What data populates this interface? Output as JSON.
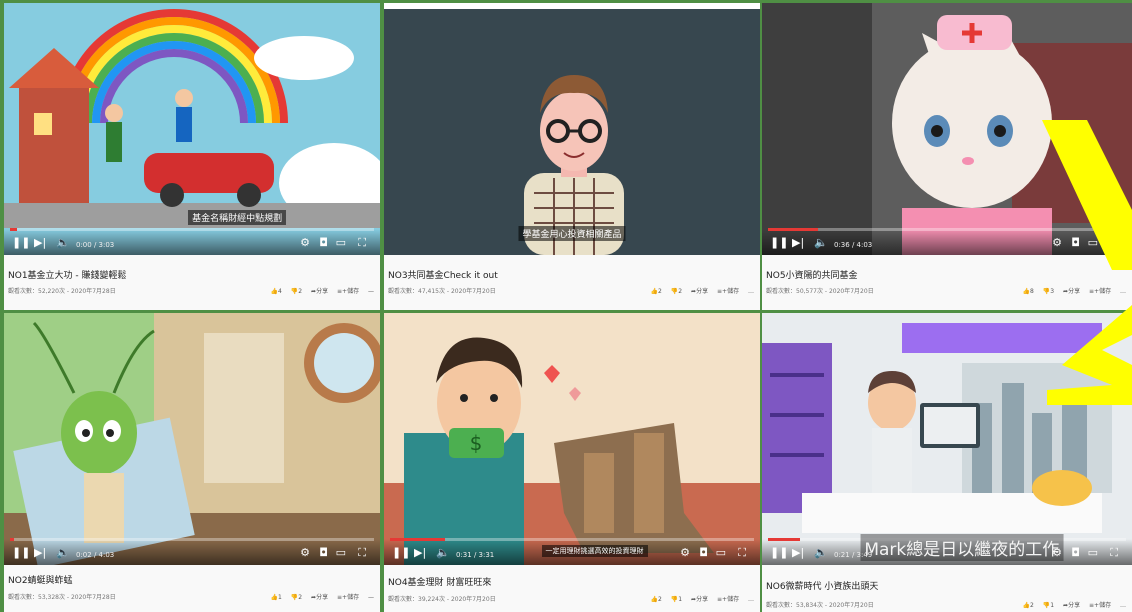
{
  "videos": [
    {
      "title": "NO1基金立大功 - 賺錢變輕鬆",
      "meta": "觀看次數：52,220次 - 2020年7月28日",
      "likes": "4",
      "dislikes": "2",
      "share": "分享",
      "save": "儲存",
      "time": "0:00 / 3:03",
      "subtitle": "基金名稱財經中點規劃"
    },
    {
      "title": "NO3共同基金Check it out",
      "meta": "觀看次數：47,415次 - 2020年7月20日",
      "likes": "2",
      "dislikes": "2",
      "share": "分享",
      "save": "儲存",
      "time": "",
      "subtitle": "學基金用心投資相關產品"
    },
    {
      "title": "NO5小資陽的共同基金",
      "meta": "觀看次數：50,577次 - 2020年7月20日",
      "likes": "8",
      "dislikes": "3",
      "share": "分享",
      "save": "儲存",
      "time": "0:36 / 4:03",
      "subtitle": ""
    },
    {
      "title": "NO2蜻蜓與蚱蜢",
      "meta": "觀看次數：53,328次 - 2020年7月28日",
      "likes": "1",
      "dislikes": "2",
      "share": "分享",
      "save": "儲存",
      "time": "0:02 / 4:03",
      "subtitle": ""
    },
    {
      "title": "NO4基金理財 財富旺旺來",
      "meta": "觀看次數：39,224次 - 2020年7月20日",
      "likes": "2",
      "dislikes": "1",
      "share": "分享",
      "save": "儲存",
      "time": "0:31 / 3:31",
      "subtitle": "一定用理財挑選高效的投資理財"
    },
    {
      "title": "NO6微薪時代 小資族出頭天",
      "meta": "觀看次數：53,834次 - 2020年7月20日",
      "likes": "2",
      "dislikes": "1",
      "share": "分享",
      "save": "儲存",
      "time": "0:21 / 3:49",
      "subtitle": "Mark總是日以繼夜的工作"
    }
  ],
  "icons": {
    "play": "pause-icon",
    "next": "next-icon",
    "volume": "volume-icon",
    "settings": "gear-icon",
    "miniplayer": "miniplayer-icon",
    "theater": "theater-icon",
    "fullscreen": "fullscreen-icon",
    "like": "thumbs-up-icon",
    "dislike": "thumbs-down-icon",
    "share": "share-icon",
    "save": "save-icon",
    "more": "more-icon"
  },
  "colors": {
    "background": "#4f8f44",
    "overlay": "#ffff00",
    "progress": "#e53935"
  }
}
